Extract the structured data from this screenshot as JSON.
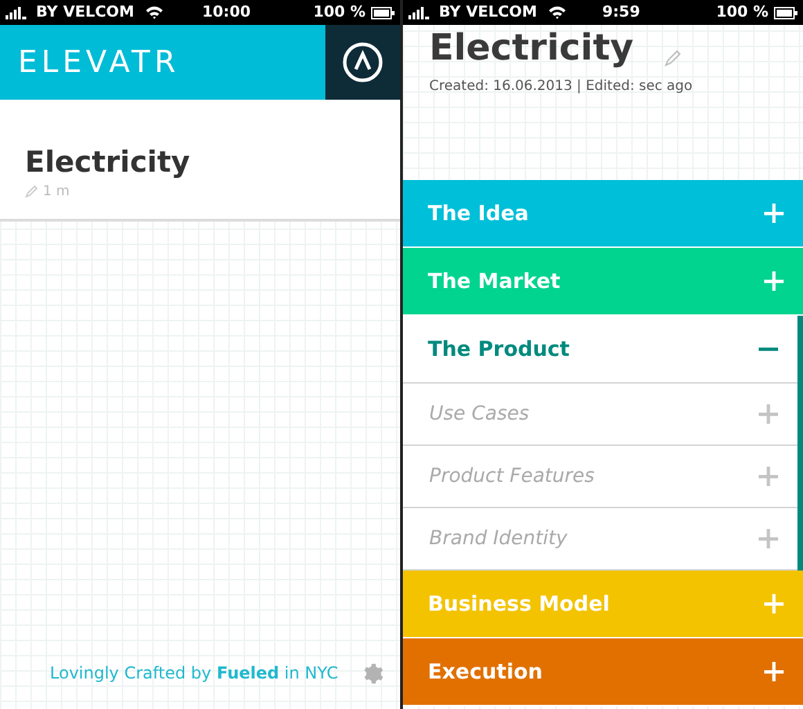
{
  "screens": [
    {
      "status_bar": {
        "carrier": "BY VELCOM",
        "time": "10:00",
        "battery": "100 %"
      },
      "header": {
        "logo": "ELEVATR"
      },
      "notes": [
        {
          "title": "Electricity",
          "meta": "1 m"
        }
      ],
      "footer": {
        "text": "Lovingly Crafted by **Fueled** in NYC"
      }
    },
    {
      "status_bar": {
        "carrier": "BY VELCOM",
        "time": "9:59",
        "battery": "100 %"
      },
      "note": {
        "title": "Electricity",
        "meta": "Created: 16.06.2013 | Edited: sec ago"
      },
      "sections": [
        {
          "label": "The Idea",
          "color": "#00bfd8",
          "expanded": false
        },
        {
          "label": "The Market",
          "color": "#00d48f",
          "expanded": false
        },
        {
          "label": "The Product",
          "color": "#008a7e",
          "expanded": true,
          "children": [
            {
              "label": "Use Cases"
            },
            {
              "label": "Product Features"
            },
            {
              "label": "Brand Identity"
            }
          ]
        },
        {
          "label": "Business Model",
          "color": "#f3c300",
          "expanded": false
        },
        {
          "label": "Execution",
          "color": "#e17000",
          "expanded": false
        }
      ]
    }
  ]
}
